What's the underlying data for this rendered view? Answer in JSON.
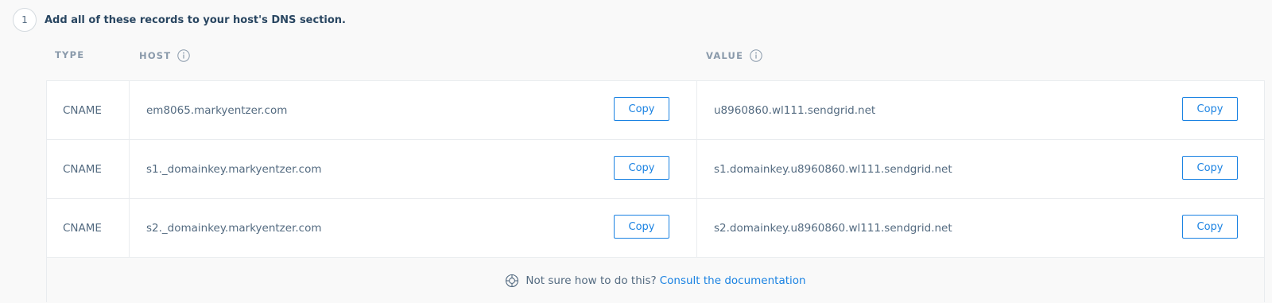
{
  "step": {
    "number": "1",
    "title": "Add all of these records to your host's DNS section."
  },
  "columns": {
    "type": "TYPE",
    "host": "HOST",
    "value": "VALUE"
  },
  "records": [
    {
      "type": "CNAME",
      "host": "em8065.markyentzer.com",
      "value": "u8960860.wl111.sendgrid.net",
      "copy_label": "Copy"
    },
    {
      "type": "CNAME",
      "host": "s1._domainkey.markyentzer.com",
      "value": "s1.domainkey.u8960860.wl111.sendgrid.net",
      "copy_label": "Copy"
    },
    {
      "type": "CNAME",
      "host": "s2._domainkey.markyentzer.com",
      "value": "s2.domainkey.u8960860.wl111.sendgrid.net",
      "copy_label": "Copy"
    }
  ],
  "footer": {
    "prompt": "Not sure how to do this?",
    "link": "Consult the documentation"
  },
  "colors": {
    "accent": "#1a82e2",
    "text": "#546b81",
    "heading": "#294661"
  },
  "icons": {
    "info": "info-icon",
    "help": "lifebuoy-icon"
  }
}
